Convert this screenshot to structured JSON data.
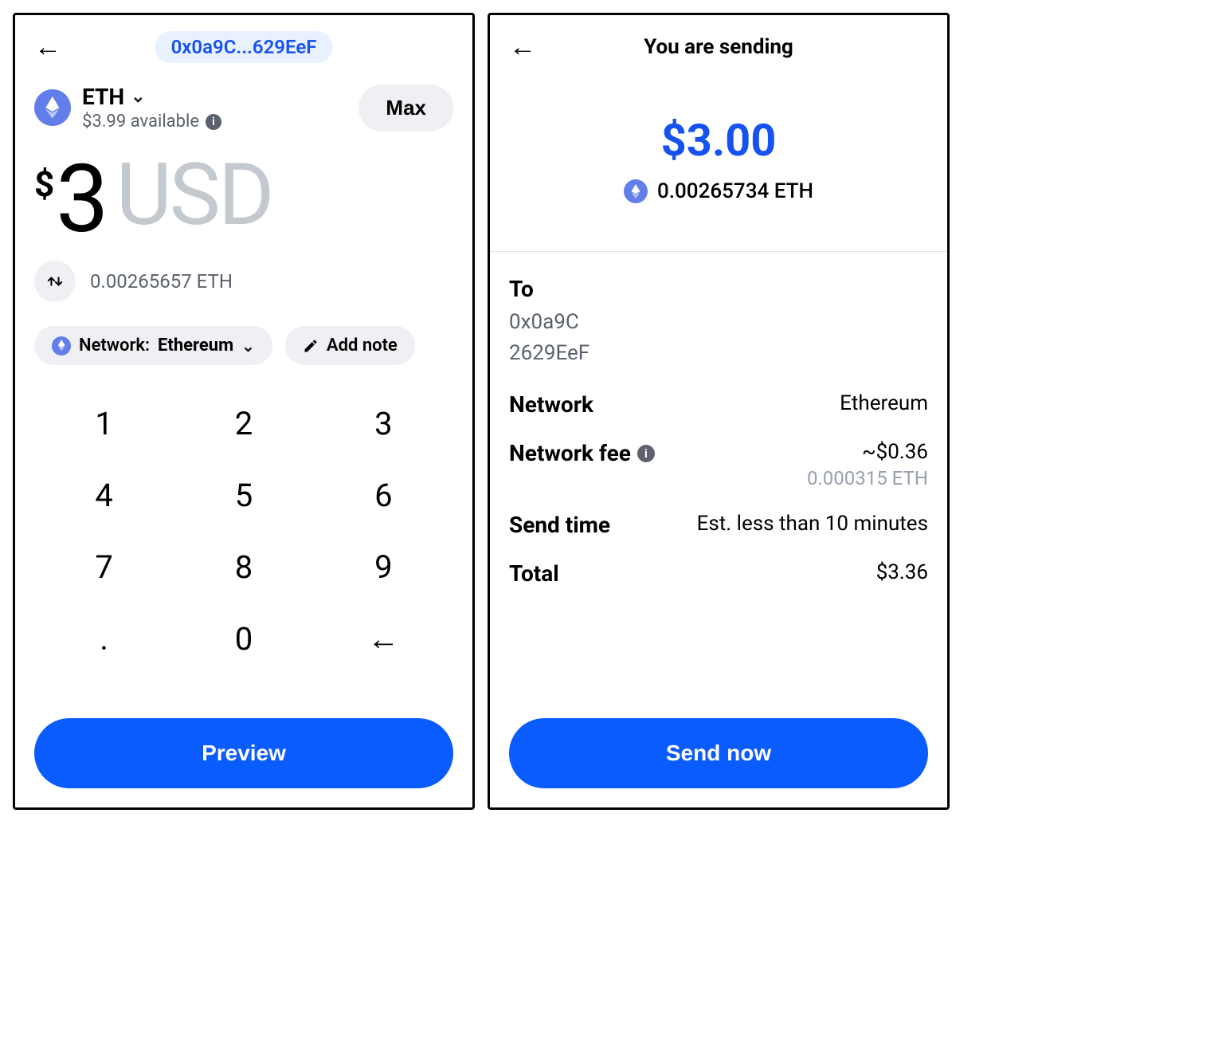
{
  "left": {
    "recipient_short": "0x0a9C...629EeF",
    "asset": {
      "symbol": "ETH",
      "available_label": "$3.99 available"
    },
    "max_label": "Max",
    "amount": {
      "currency_symbol": "$",
      "value": "3",
      "fiat_code": "USD",
      "crypto_equiv": "0.00265657 ETH"
    },
    "network_chip": {
      "prefix": "Network:",
      "value": "Ethereum"
    },
    "add_note_label": "Add note",
    "keypad": [
      "1",
      "2",
      "3",
      "4",
      "5",
      "6",
      "7",
      "8",
      "9",
      ".",
      "0",
      "←"
    ],
    "preview_label": "Preview"
  },
  "right": {
    "title": "You are sending",
    "amount_usd": "$3.00",
    "amount_crypto": "0.00265734 ETH",
    "to_label": "To",
    "to_line1": "0x0a9C",
    "to_line2": "2629EeF",
    "network_label": "Network",
    "network_value": "Ethereum",
    "fee_label": "Network fee",
    "fee_usd": "~$0.36",
    "fee_crypto": "0.000315 ETH",
    "send_time_label": "Send time",
    "send_time_value": "Est. less than 10 minutes",
    "total_label": "Total",
    "total_value": "$3.36",
    "send_now_label": "Send now"
  }
}
